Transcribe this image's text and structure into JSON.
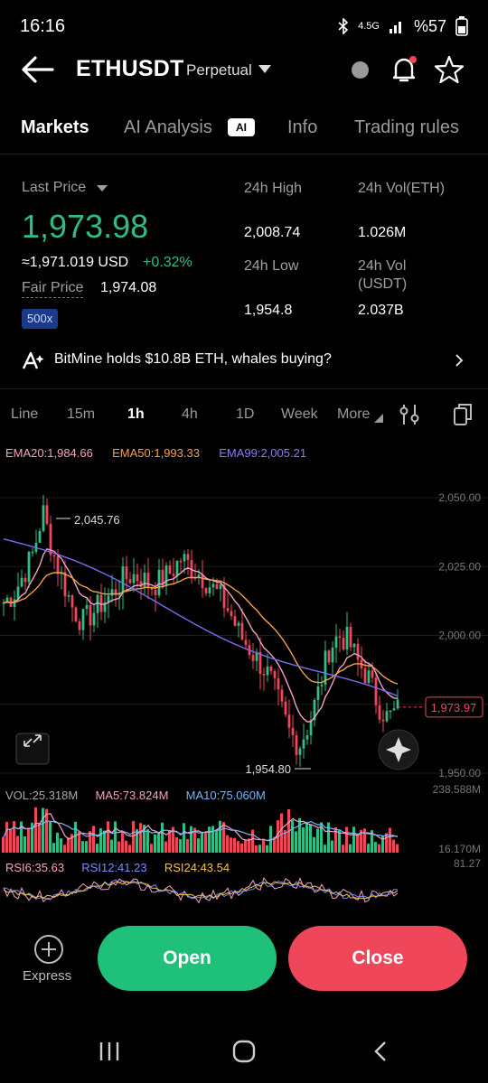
{
  "status": {
    "time": "16:16",
    "battery": "%57",
    "network": "4.5G"
  },
  "header": {
    "pair": "ETHUSDT",
    "pair_type": "Perpetual"
  },
  "tabs": [
    {
      "label": "Markets",
      "active": true
    },
    {
      "label": "AI Analysis",
      "active": false
    },
    {
      "label": "Info",
      "active": false
    },
    {
      "label": "Trading rules",
      "active": false
    }
  ],
  "ai_badge": "AI",
  "price": {
    "last_label": "Last Price",
    "last": "1,973.98",
    "approx": "≈1,971.019 USD",
    "change": "+0.32%",
    "fair_label": "Fair Price",
    "fair": "1,974.08",
    "leverage": "500x"
  },
  "stats": {
    "high_label": "24h High",
    "high": "2,008.74",
    "low_label": "24h Low",
    "low": "1,954.8",
    "vol_eth_label": "24h Vol(ETH)",
    "vol_eth": "1.026M",
    "vol_usdt_label": "24h Vol (USDT)",
    "vol_usdt": "2.037B"
  },
  "news": {
    "text": "BitMine holds $10.8B ETH, whales buying?"
  },
  "timeframes": [
    {
      "label": "Line",
      "active": false
    },
    {
      "label": "15m",
      "active": false
    },
    {
      "label": "1h",
      "active": true
    },
    {
      "label": "4h",
      "active": false
    },
    {
      "label": "1D",
      "active": false
    },
    {
      "label": "Week",
      "active": false
    },
    {
      "label": "More",
      "active": false
    }
  ],
  "indicators": {
    "ema20": "EMA20:1,984.66",
    "ema50": "EMA50:1,993.33",
    "ema99": "EMA99:2,005.21",
    "vol": "VOL:25.318M",
    "ma5": "MA5:73.824M",
    "ma10": "MA10:75.060M",
    "rsi6": "RSI6:35.63",
    "rsi12": "RSI12:41.23",
    "rsi24": "RSI24:43.54"
  },
  "colors": {
    "up": "#2ebd85",
    "down": "#f0465a",
    "ema20": "#f0a3c8",
    "ema50": "#f5a04a",
    "ema99": "#7a6cf0"
  },
  "chart_data": {
    "type": "candlestick",
    "price_axis_labels": [
      "2,050.00",
      "2,025.00",
      "2,000.00",
      "1,975.00",
      "1,950.00"
    ],
    "ylim": [
      1950,
      2050
    ],
    "high_marker": "2,045.76",
    "low_marker": "1,954.80",
    "current_price": "1,973.97",
    "volume_axis_top": "238.588M",
    "volume_axis_bottom": "16.170M",
    "rsi_axis_top": "81.27"
  },
  "actions": {
    "express": "Express",
    "open": "Open",
    "close": "Close"
  }
}
